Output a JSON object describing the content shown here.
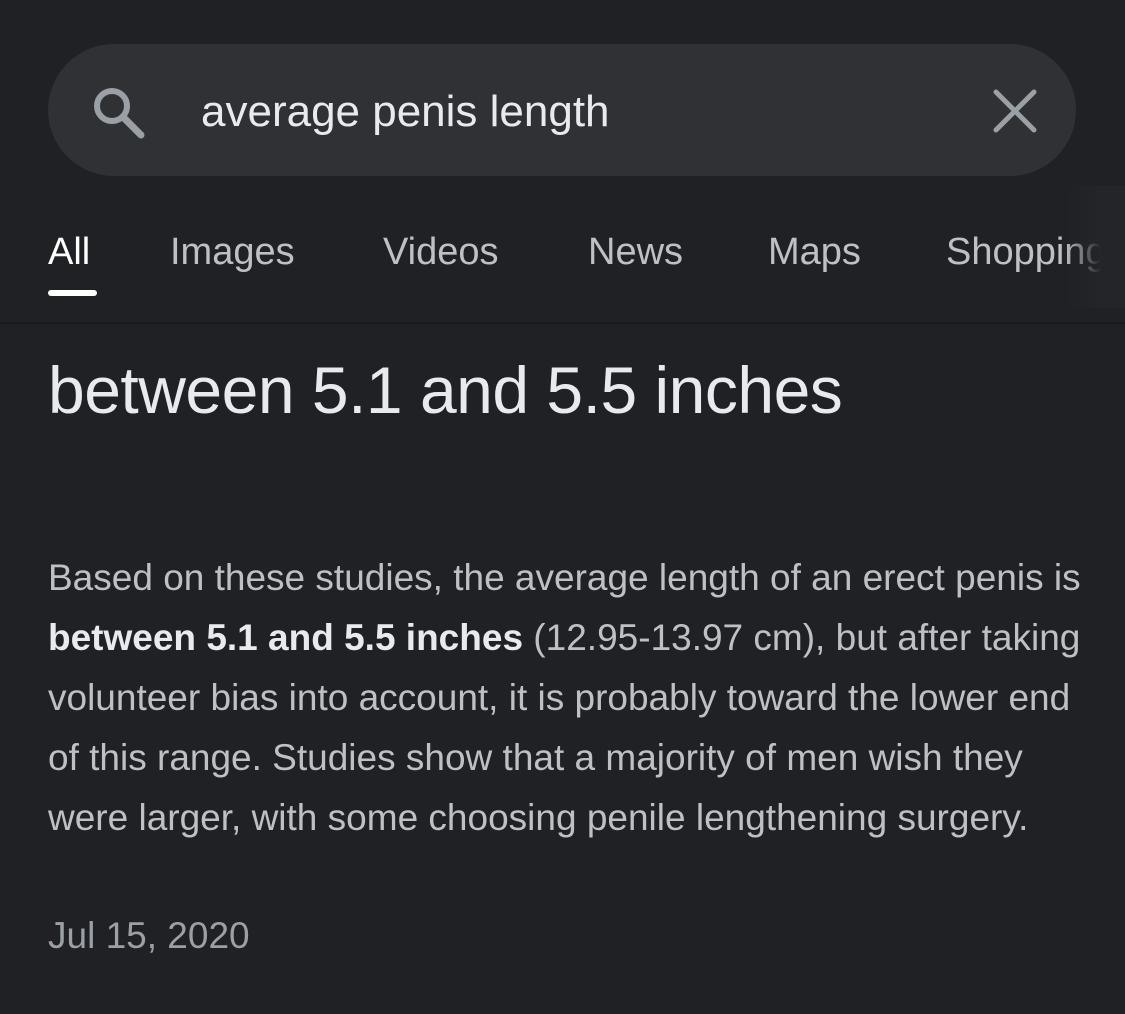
{
  "search": {
    "query": "average penis length",
    "icon": "search-icon",
    "clear_icon": "close-icon"
  },
  "tabs": [
    {
      "label": "All",
      "active": true
    },
    {
      "label": "Images",
      "active": false
    },
    {
      "label": "Videos",
      "active": false
    },
    {
      "label": "News",
      "active": false
    },
    {
      "label": "Maps",
      "active": false
    },
    {
      "label": "Shopping",
      "active": false
    }
  ],
  "snippet": {
    "answer": "between 5.1 and 5.5 inches",
    "text_before": "Based on these studies, the average length of an erect penis is ",
    "text_bold": "between 5.1 and 5.5 inches",
    "text_after": " (12.95-13.97 cm), but after taking volunteer bias into account, it is probably toward the lower end of this range. Studies show that a majority of men wish they were larger, with some choosing penile lengthening surgery.",
    "date": "Jul 15, 2020"
  },
  "colors": {
    "background": "#202124",
    "search_box": "#303134",
    "text_primary": "#e8eaed",
    "text_secondary": "#bdc1c6",
    "text_muted": "#9aa0a6"
  }
}
